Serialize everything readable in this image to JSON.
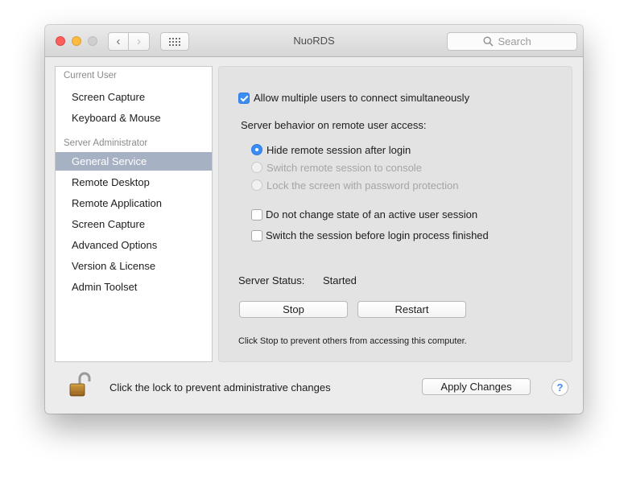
{
  "window": {
    "title": "NuoRDS"
  },
  "toolbar": {
    "back_icon": "‹",
    "forward_icon": "›",
    "search_placeholder": "Search"
  },
  "sidebar": {
    "groups": [
      {
        "header": "Current User",
        "items": [
          "Screen Capture",
          "Keyboard & Mouse"
        ]
      },
      {
        "header": "Server Administrator",
        "items": [
          "General Service",
          "Remote Desktop",
          "Remote Application",
          "Screen Capture",
          "Advanced Options",
          "Version & License",
          "Admin Toolset"
        ]
      }
    ],
    "selected": "General Service"
  },
  "general": {
    "allow_multiple": {
      "label": "Allow multiple users to connect simultaneously",
      "checked": true
    },
    "behavior_heading": "Server behavior on remote user access:",
    "radios": [
      {
        "label": "Hide remote session after login",
        "checked": true,
        "enabled": true
      },
      {
        "label": "Switch remote session to console",
        "checked": false,
        "enabled": false
      },
      {
        "label": "Lock the screen with password protection",
        "checked": false,
        "enabled": false
      }
    ],
    "no_change_state": {
      "label": "Do not change state of an active user session",
      "checked": false
    },
    "switch_before_login": {
      "label": "Switch the session before login process finished",
      "checked": false
    },
    "status_label": "Server Status:",
    "status_value": "Started",
    "stop_label": "Stop",
    "restart_label": "Restart",
    "note": "Click Stop to prevent others from accessing this computer."
  },
  "footer": {
    "lock_text": "Click the lock to prevent administrative changes",
    "apply_label": "Apply Changes",
    "help_label": "?"
  },
  "colors": {
    "accent": "#3b8cf4",
    "selection": "#a7b1c4",
    "close": "#fc605c",
    "minimize": "#fdbc40"
  },
  "icons": [
    "close-button",
    "minimize-button",
    "zoom-button",
    "chevron-left-icon",
    "chevron-right-icon",
    "grid-icon",
    "magnifier-icon",
    "padlock-icon",
    "help-icon"
  ]
}
